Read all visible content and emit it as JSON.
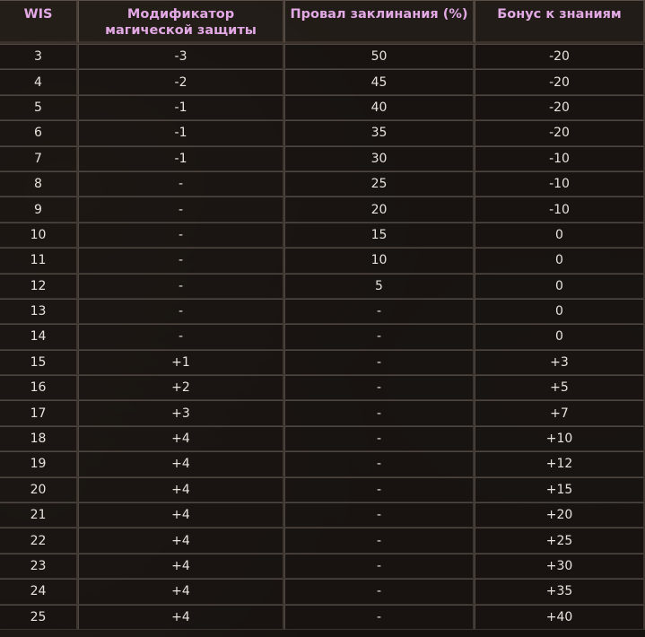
{
  "table": {
    "headers": [
      "WIS",
      "Модификатор магической защиты",
      "Провал заклинания (%)",
      "Бонус к знаниям"
    ],
    "rows": [
      [
        "3",
        "-3",
        "50",
        "-20"
      ],
      [
        "4",
        "-2",
        "45",
        "-20"
      ],
      [
        "5",
        "-1",
        "40",
        "-20"
      ],
      [
        "6",
        "-1",
        "35",
        "-20"
      ],
      [
        "7",
        "-1",
        "30",
        "-10"
      ],
      [
        "8",
        "-",
        "25",
        "-10"
      ],
      [
        "9",
        "-",
        "20",
        "-10"
      ],
      [
        "10",
        "-",
        "15",
        "0"
      ],
      [
        "11",
        "-",
        "10",
        "0"
      ],
      [
        "12",
        "-",
        "5",
        "0"
      ],
      [
        "13",
        "-",
        "-",
        "0"
      ],
      [
        "14",
        "-",
        "-",
        "0"
      ],
      [
        "15",
        "+1",
        "-",
        "+3"
      ],
      [
        "16",
        "+2",
        "-",
        "+5"
      ],
      [
        "17",
        "+3",
        "-",
        "+7"
      ],
      [
        "18",
        "+4",
        "-",
        "+10"
      ],
      [
        "19",
        "+4",
        "-",
        "+12"
      ],
      [
        "20",
        "+4",
        "-",
        "+15"
      ],
      [
        "21",
        "+4",
        "-",
        "+20"
      ],
      [
        "22",
        "+4",
        "-",
        "+25"
      ],
      [
        "23",
        "+4",
        "-",
        "+30"
      ],
      [
        "24",
        "+4",
        "-",
        "+35"
      ],
      [
        "25",
        "+4",
        "-",
        "+40"
      ]
    ]
  },
  "colors": {
    "header_text": "#e2a9e4",
    "cell_text": "#e8e3dc",
    "background": "#16120f"
  }
}
